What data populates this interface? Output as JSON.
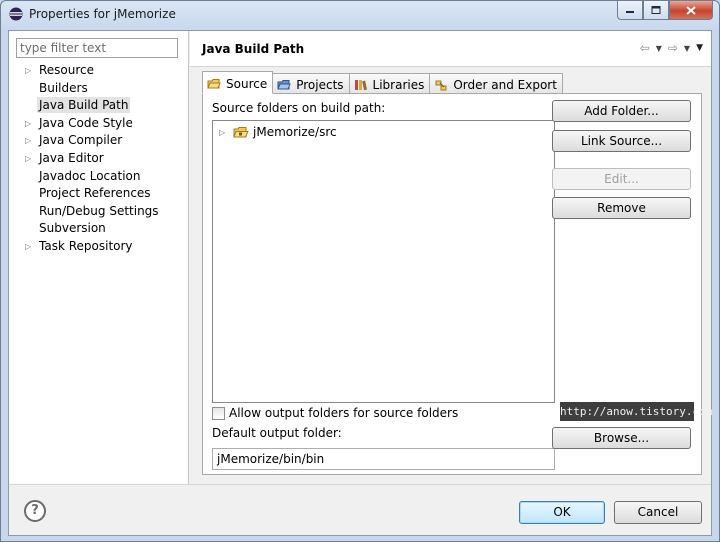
{
  "window": {
    "title": "Properties for jMemorize",
    "icon": "eclipse-icon"
  },
  "window_buttons": [
    "minimize-icon",
    "maximize-icon",
    "close-icon"
  ],
  "filter": {
    "placeholder": "type filter text",
    "value": ""
  },
  "nav": {
    "items": [
      {
        "label": "Resource",
        "expandable": true
      },
      {
        "label": "Builders",
        "expandable": false
      },
      {
        "label": "Java Build Path",
        "expandable": false,
        "selected": true
      },
      {
        "label": "Java Code Style",
        "expandable": true
      },
      {
        "label": "Java Compiler",
        "expandable": true
      },
      {
        "label": "Java Editor",
        "expandable": true
      },
      {
        "label": "Javadoc Location",
        "expandable": false
      },
      {
        "label": "Project References",
        "expandable": false
      },
      {
        "label": "Run/Debug Settings",
        "expandable": false
      },
      {
        "label": "Subversion",
        "expandable": false
      },
      {
        "label": "Task Repository",
        "expandable": true
      }
    ]
  },
  "page": {
    "title": "Java Build Path"
  },
  "tabs": [
    {
      "label": "Source",
      "icon": "source-folder-icon",
      "active": true
    },
    {
      "label": "Projects",
      "icon": "project-folder-icon",
      "active": false
    },
    {
      "label": "Libraries",
      "icon": "library-icon",
      "active": false
    },
    {
      "label": "Order and Export",
      "icon": "order-export-icon",
      "active": false
    }
  ],
  "source": {
    "folders_label": "Source folders on build path:",
    "tree_items": [
      {
        "label": "jMemorize/src",
        "icon": "package-folder-icon"
      }
    ],
    "buttons": {
      "add_folder": "Add Folder...",
      "link_source": "Link Source...",
      "edit": "Edit...",
      "remove": "Remove",
      "browse": "Browse..."
    },
    "allow_output_label": "Allow output folders for source folders",
    "allow_output_checked": false,
    "default_output_label": "Default output folder:",
    "default_output_value": "jMemorize/bin/bin"
  },
  "watermark": "http://anow.tistory.com",
  "dialog_buttons": {
    "help": "?",
    "ok": "OK",
    "cancel": "Cancel"
  },
  "colors": {
    "accent": "#3c7fb1",
    "close_button": "#c6442c"
  }
}
